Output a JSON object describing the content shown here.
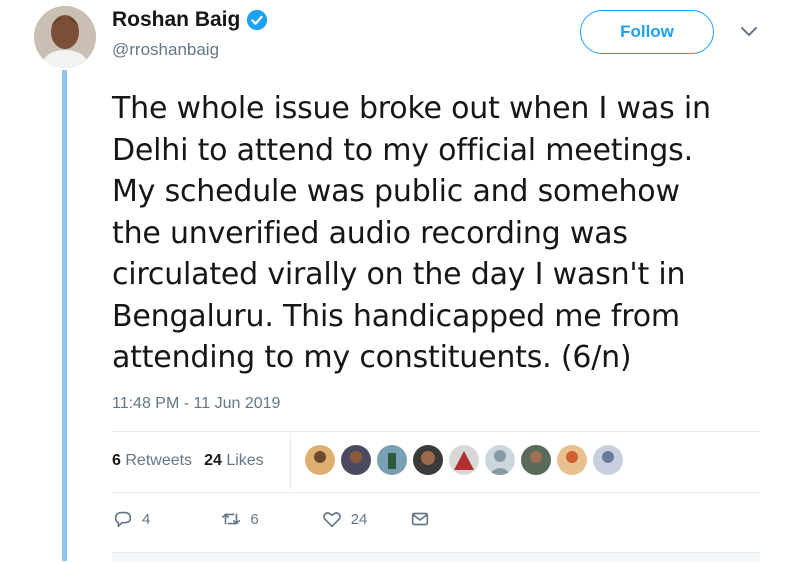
{
  "author": {
    "display_name": "Roshan Baig",
    "handle": "@rroshanbaig",
    "verified": true
  },
  "follow_label": "Follow",
  "tweet": {
    "lines": [
      "The whole issue broke out when I was in",
      "Delhi to attend to my official meetings.",
      "My schedule was public and somehow",
      "the unverified audio recording was",
      "circulated virally on the day I wasn't in",
      "Bengaluru. This handicapped me from",
      "attending to my constituents. (6/n)"
    ],
    "timestamp": "11:48 PM - 11 Jun 2019"
  },
  "stats": {
    "retweets_count": "6",
    "retweets_label": "Retweets",
    "likes_count": "24",
    "likes_label": "Likes"
  },
  "actions": {
    "reply_count": "4",
    "retweet_count": "6",
    "like_count": "24"
  },
  "colors": {
    "accent": "#1da1f2",
    "thread_line": "#8ec4ec",
    "muted_text": "#657786"
  }
}
